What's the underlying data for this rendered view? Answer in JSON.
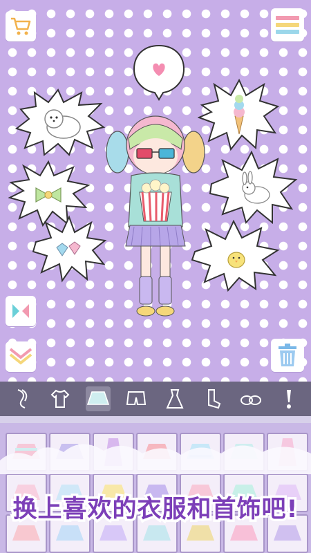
{
  "scene": {
    "heart_bubble_icon": "heart-icon",
    "accessories": [
      {
        "name": "dog-icon"
      },
      {
        "name": "bow-icon"
      },
      {
        "name": "gems-icon"
      },
      {
        "name": "ice-cream-icon"
      },
      {
        "name": "bunny-icon"
      },
      {
        "name": "chick-icon"
      }
    ]
  },
  "controls": {
    "shop_icon": "cart-icon",
    "menu_icon": "menu-icon",
    "flip_icon": "flip-icon",
    "layer_icon": "layer-icon",
    "trash_icon": "trash-icon"
  },
  "toolbar": {
    "categories": [
      "hair",
      "top",
      "skirt",
      "shorts",
      "dress",
      "socks",
      "shoes",
      "accessory"
    ],
    "active": "skirt"
  },
  "colors": {
    "background": "#c7aee8",
    "banner_text": "#7c3fb8",
    "toolbar": "#6b6680"
  },
  "banner": {
    "text": "换上喜欢的衣服和首饰吧!"
  }
}
